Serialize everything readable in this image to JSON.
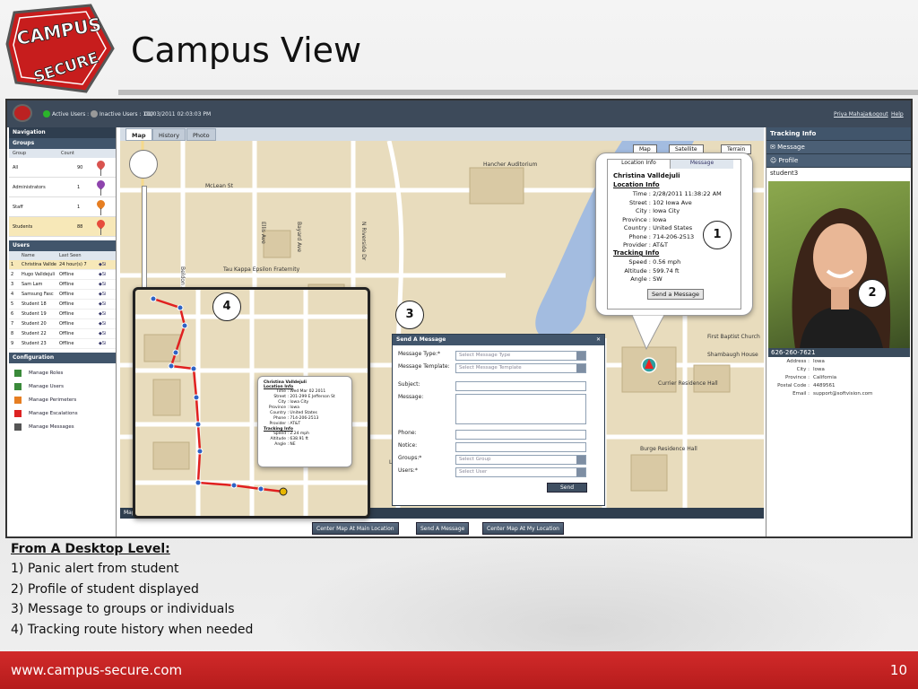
{
  "slide": {
    "title": "Campus View",
    "page_number": "10",
    "footer_url": "www.campus-secure.com",
    "logo_text_top": "CAMPUS",
    "logo_text_bottom": "SECURE"
  },
  "topbar": {
    "active_users": "Active Users : 2",
    "inactive_users": "Inactive Users : 110",
    "datetime": "01/03/2011 02:03:03 PM",
    "user_name": "Priya Mahajan",
    "logout": "Logout",
    "help": "Help"
  },
  "left": {
    "navigation": "Navigation",
    "groups_header": "Groups",
    "groups_cols": [
      "Group",
      "Count"
    ],
    "groups": [
      {
        "name": "All",
        "count": "90",
        "color": "#d9534f"
      },
      {
        "name": "Administrators",
        "count": "1",
        "color": "#8e44ad"
      },
      {
        "name": "Staff",
        "count": "1",
        "color": "#e67e22"
      },
      {
        "name": "Students",
        "count": "88",
        "color": "#e74c3c"
      }
    ],
    "users_header": "Users",
    "users_cols": [
      "Name",
      "Last Seen"
    ],
    "users": [
      {
        "n": "1",
        "name": "Christina Vallde",
        "seen": "24 hour(s) 7"
      },
      {
        "n": "2",
        "name": "Hugo Valldejuli",
        "seen": "Offline"
      },
      {
        "n": "3",
        "name": "Sam Lam",
        "seen": "Offline"
      },
      {
        "n": "4",
        "name": "Samsung Fasc",
        "seen": "Offline"
      },
      {
        "n": "5",
        "name": "Student 18",
        "seen": "Offline"
      },
      {
        "n": "6",
        "name": "Student 19",
        "seen": "Offline"
      },
      {
        "n": "7",
        "name": "Student 20",
        "seen": "Offline"
      },
      {
        "n": "8",
        "name": "Student 22",
        "seen": "Offline"
      },
      {
        "n": "9",
        "name": "Student 23",
        "seen": "Offline"
      }
    ],
    "config_header": "Configuration",
    "config_items": [
      "Manage Roles",
      "Manage Users",
      "Manage Perimeters",
      "Manage Escalations",
      "Manage Messages"
    ]
  },
  "map": {
    "tabs": [
      "Map",
      "History",
      "Photo"
    ],
    "map_type_buttons": [
      "Map",
      "Satellite",
      "Terrain"
    ],
    "streets": [
      "McLean St",
      "Beldon Ave",
      "Ellis Ave",
      "Bayard Ave",
      "N Riverside Dr",
      "Linn",
      "Hancher Auditorium",
      "Tau Kappa Epsilon Fraternity",
      "First Baptist Church",
      "Shambaugh House",
      "Currier Residence Hall",
      "Burge Residence Hall"
    ],
    "footer_label": "Map",
    "buttons": [
      "Center Map At Main Location",
      "Send A Message",
      "Center Map At My Location"
    ]
  },
  "info_popup": {
    "tabs": [
      "Location Info",
      "Message"
    ],
    "name": "Christina Valldejuli",
    "location_header": "Location Info",
    "rows": [
      {
        "k": "Time :",
        "v": "2/28/2011 11:38:22 AM"
      },
      {
        "k": "Street :",
        "v": "102 Iowa Ave"
      },
      {
        "k": "City :",
        "v": "Iowa City"
      },
      {
        "k": "Province :",
        "v": "Iowa"
      },
      {
        "k": "Country :",
        "v": "United States"
      },
      {
        "k": "Phone :",
        "v": "714-206-2513"
      },
      {
        "k": "Provider :",
        "v": "AT&T"
      }
    ],
    "tracking_header": "Tracking Info",
    "tracking_rows": [
      {
        "k": "Speed :",
        "v": "0.56 mph"
      },
      {
        "k": "Altitude :",
        "v": "599.74 ft"
      },
      {
        "k": "Angle :",
        "v": "SW"
      }
    ],
    "button": "Send a Message"
  },
  "message_dialog": {
    "title": "Send A Message",
    "fields": [
      {
        "label": "Message Type:",
        "value": "Select Message Type",
        "required": true
      },
      {
        "label": "Message Template:",
        "value": "Select Message Template",
        "required": false
      },
      {
        "label": "Subject:",
        "value": "",
        "required": false
      },
      {
        "label": "Message:",
        "value": "",
        "required": false
      },
      {
        "label": "Phone:",
        "value": "",
        "required": false
      },
      {
        "label": "Notice:",
        "value": "",
        "required": false
      },
      {
        "label": "Groups:",
        "value": "Select Group",
        "required": true
      },
      {
        "label": "Users:",
        "value": "Select User",
        "required": true
      }
    ],
    "send": "Send"
  },
  "right": {
    "tracking_info": "Tracking Info",
    "message": "Message",
    "profile": "Profile",
    "student_id": "student3",
    "phone": "626-260-7621",
    "address_rows": [
      {
        "k": "Address :",
        "v": "Iowa"
      },
      {
        "k": "City :",
        "v": "Iowa"
      },
      {
        "k": "Province :",
        "v": "California"
      },
      {
        "k": "Postal Code :",
        "v": "4489561"
      },
      {
        "k": "Email :",
        "v": "support@softvision.com"
      }
    ]
  },
  "inset_popup": {
    "name": "Christina Valldejuli",
    "header": "Location Info",
    "rows": [
      {
        "k": "Time :",
        "v": "Wed Mar 02 2011"
      },
      {
        "k": "Street :",
        "v": "201-299 E Jefferson St"
      },
      {
        "k": "City :",
        "v": "Iowa City"
      },
      {
        "k": "Province :",
        "v": "Iowa"
      },
      {
        "k": "Country :",
        "v": "United States"
      },
      {
        "k": "Phone :",
        "v": "714-206-2513"
      },
      {
        "k": "Provider :",
        "v": "AT&T"
      }
    ],
    "tracking_header": "Tracking Info",
    "tracking_rows": [
      {
        "k": "Speed :",
        "v": "2.24 mph"
      },
      {
        "k": "Altitude :",
        "v": "638.91 ft"
      },
      {
        "k": "Angle :",
        "v": "NE"
      }
    ]
  },
  "callouts": [
    "1",
    "2",
    "3",
    "4"
  ],
  "notes": {
    "heading": "From A Desktop Level:",
    "items": [
      "1) Panic alert from student",
      "2) Profile of student displayed",
      "3) Message to groups or individuals",
      "4) Tracking route history when needed"
    ]
  },
  "colors": {
    "footer_red": "#c62323",
    "header_blue": "#41556b",
    "route_red": "#e02020"
  }
}
